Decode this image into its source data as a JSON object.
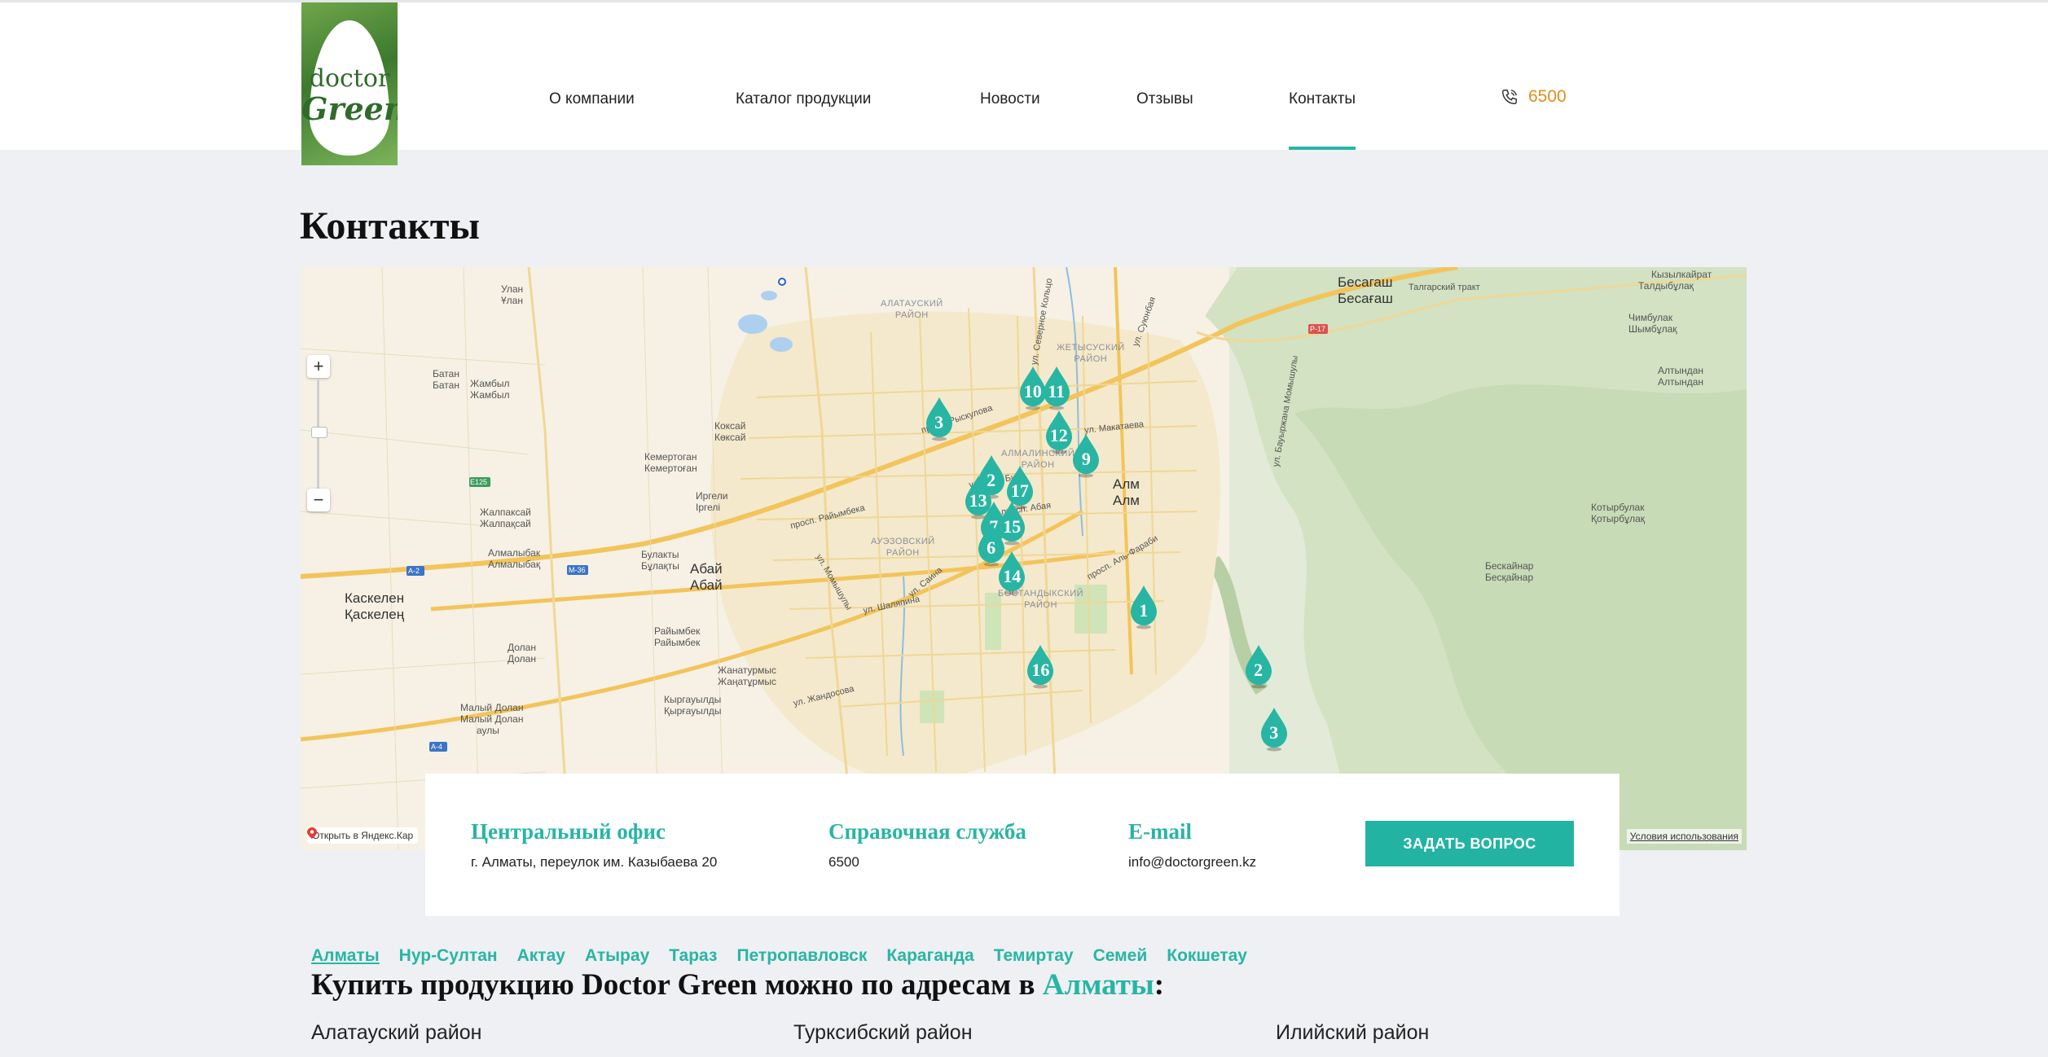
{
  "header": {
    "logo": {
      "line1": "doctor",
      "line2": "Green"
    },
    "nav": [
      {
        "label": "О компании"
      },
      {
        "label": "Каталог продукции"
      },
      {
        "label": "Новости"
      },
      {
        "label": "Отзывы"
      },
      {
        "label": "Контакты",
        "active": true
      }
    ],
    "phone": "6500"
  },
  "page_title": "Контакты",
  "map": {
    "labels": {
      "bekasagash": "Бесагаш",
      "bekasagash2": "Бесағаш",
      "talgar_tract": "Талгарский тракт",
      "kyzylkairat": "Кызылкайрат",
      "taldybulak": "Талдыбұлақ",
      "chimbulak": "Чимбулак",
      "shymbulak": "Шымбұлақ",
      "altyndan": "Алтындан",
      "altyndan2": "Алтындан",
      "kotyrbulak": "Котырбулак",
      "kotyrbulak2": "Қотырбұлақ",
      "beskainar": "Бескайнар",
      "beskainar2": "Бесқайнар",
      "ulan": "Улан",
      "ulan2": "Ұлан",
      "batan": "Батан",
      "batan2": "Батан",
      "zhambyl": "Жамбыл",
      "zhambyl2": "Жамбыл",
      "koksai": "Коксай",
      "koksai2": "Көксай",
      "kemertogan": "Кемертоган",
      "kemertogan2": "Кемертоған",
      "irgeli": "Иргели",
      "irgeli2": "Іргелі",
      "zhalpaksai": "Жалпаксай",
      "zhalpaksai2": "Жалпақсай",
      "almalybak": "Алмалыбак",
      "almalybak2": "Алмалыбақ",
      "bulakty": "Булакты",
      "bulakty2": "Бұлақты",
      "abai": "Абай",
      "abai2": "Абай",
      "kaskelen": "Каскелен",
      "kaskelen2": "Қаскелең",
      "raiymbek": "Райымбек",
      "raiymbek2": "Райымбек",
      "zhanaturmys": "Жанатурмыс",
      "zhanaturmys2": "Жаңатұрмыс",
      "dolan": "Долан",
      "dolan2": "Долан",
      "maly_dolan": "Малый Долан",
      "maly_dolan2": "Малый Долан",
      "maly_dolan3": "аулы",
      "kyrgauyldy": "Кыргауылды",
      "kyrgauyldy2": "Қырғауылды",
      "almaty": "Алм",
      "almaty2": "Алм",
      "alatau_dist": "АЛАТАУСКИЙ\nРАЙОН",
      "zhetysu_dist": "ЖЕТЫСУСКИЙ\nРАЙОН",
      "almaly_dist": "АЛМАЛИНСКИЙ\nРАЙОН",
      "auezov_dist": "АУЭЗОВСКИЙ\nРАЙОН",
      "bostandyk_dist": "БОСТАНДЫКСКИЙ\nРАЙОН",
      "e125": "E125",
      "a2": "A-2",
      "m36": "M-36",
      "a4": "A-4",
      "p17": "P-17"
    },
    "streets": [
      "просп. Райымбека",
      "просп. Рыскулова",
      "ул. Толе Би",
      "просп. Абая",
      "ул. Макатаева",
      "ул. Шаляпина",
      "ул. Саина",
      "ул. Жандосова",
      "ул. Момышулы",
      "просп. Аль-Фараби",
      "ул. Суюнбая",
      "ул. Северное Кольцо",
      "ул. Бауыржана Момышулы"
    ],
    "markers": [
      {
        "n": "1"
      },
      {
        "n": "2"
      },
      {
        "n": "3"
      },
      {
        "n": "3"
      },
      {
        "n": "2"
      },
      {
        "n": "17"
      },
      {
        "n": "13"
      },
      {
        "n": "7"
      },
      {
        "n": "15"
      },
      {
        "n": "6"
      },
      {
        "n": "14"
      },
      {
        "n": "16"
      },
      {
        "n": "10"
      },
      {
        "n": "11"
      },
      {
        "n": "12"
      },
      {
        "n": "9"
      }
    ],
    "open_link": "Открыть в Яндекс.Кар",
    "terms": "Условия использования"
  },
  "contacts": {
    "office_title": "Центральный офис",
    "office_value": "г. Алматы, переулок им. Казыбаева 20",
    "help_title": "Справочная служба",
    "help_value": "6500",
    "email_title": "E-mail",
    "email_value": "info@doctorgreen.kz",
    "ask_button": "ЗАДАТЬ ВОПРОС"
  },
  "cities": [
    "Алматы",
    "Нур-Султан",
    "Актау",
    "Атырау",
    "Тараз",
    "Петропавловск",
    "Караганда",
    "Темиртау",
    "Семей",
    "Кокшетау"
  ],
  "buy": {
    "prefix": "Купить продукцию Doctor Green можно по адресам в ",
    "city": "Алматы",
    "suffix": ":"
  },
  "districts": [
    "Алатауский район",
    "Турксибский район",
    "Илийский район"
  ],
  "colors": {
    "accent": "#28b5a4",
    "phone": "#e08d1d",
    "brand_green": "#2f6b2a"
  }
}
